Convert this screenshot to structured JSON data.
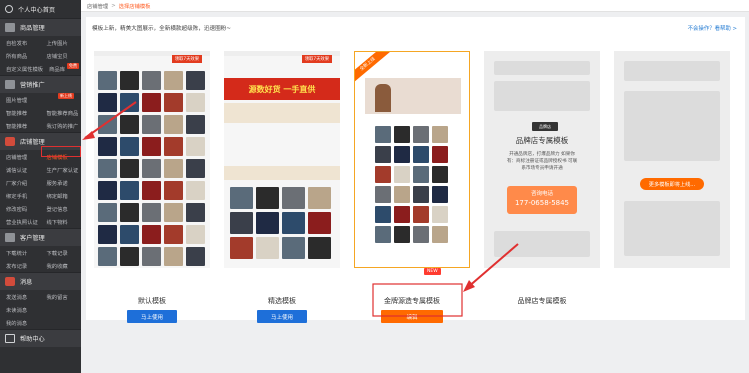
{
  "sidebar": {
    "profile": "个人中心首页",
    "sections": [
      {
        "title": "商品管理",
        "icon": "box-icon",
        "rows": [
          [
            "自检发布",
            "上传图片"
          ],
          [
            "所有商品",
            "店铺宝贝"
          ],
          [
            "自定义属性模板",
            "商品库"
          ]
        ]
      },
      {
        "title": "营销推广",
        "icon": "megaphone-icon",
        "rows": [
          [
            "图片管理",
            ""
          ],
          [
            "智能推荐",
            "智能推荐商品"
          ],
          [
            "智能推荐",
            "我订购的推广"
          ]
        ]
      },
      {
        "title": "店铺管理",
        "icon": "shop-bag-icon",
        "rows": [
          [
            "店铺管理",
            "店铺模板"
          ],
          [
            "诚信认证",
            "生产厂家认证"
          ],
          [
            "厂家介绍",
            "服务承诺"
          ],
          [
            "绑定手机",
            "绑定邮箱"
          ],
          [
            "修改密码",
            "登记信息"
          ],
          [
            "营业执照认证",
            "线下物料"
          ]
        ]
      },
      {
        "title": "客户管理",
        "icon": "person-icon",
        "rows": [
          [
            "下载统计",
            "下载记录"
          ],
          [
            "发布记录",
            "我的收藏"
          ]
        ]
      },
      {
        "title": "消息",
        "icon": "mail-icon",
        "rows": [
          [
            "发送消息",
            "我的留言"
          ],
          [
            "未读消息",
            ""
          ],
          [
            "我的消息",
            ""
          ]
        ]
      },
      {
        "title": "帮助中心",
        "icon": "question-icon",
        "rows": []
      }
    ],
    "hot_tag": "新上线",
    "free_tag": "免费",
    "active_item": "店铺模板"
  },
  "breadcrumb": {
    "parent": "店铺管理",
    "separator": ">",
    "current": "选择店铺模板"
  },
  "intro": "模板上新，精美大图展示，全新横款超级陈，迅速圈粉~",
  "help_link": "不会操作？看帮助 >",
  "templates": [
    {
      "name": "默认模板",
      "tag": "领取7天效果",
      "button": "马上使用"
    },
    {
      "name": "精选模板",
      "tag": "领取7天效果",
      "banner": "源数好货 一手直供",
      "button": "马上使用"
    },
    {
      "name": "金牌源造专属模板",
      "badge": "NEW",
      "ribbon": "全新上线",
      "button": "编辑"
    },
    {
      "name": "品牌店专属模板",
      "brand_title": "品牌店专属模板",
      "brand_desc": "开通品牌店，打爆品牌力 如果你有：商标注册证或品牌授权书 可联系市场专员申请开通",
      "phone_label": "咨询电话",
      "phone": "177-0658-5845"
    },
    {
      "name": "",
      "more": "更多模板即将上线..."
    }
  ],
  "colors": {
    "accent": "#ff6a00",
    "primary": "#1e6fd9",
    "sidebar": "#2f3033",
    "highlight": "#e03030"
  }
}
